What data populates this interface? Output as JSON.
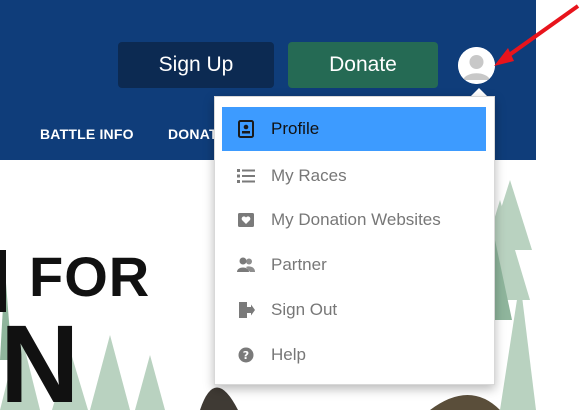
{
  "header": {
    "signup_label": "Sign Up",
    "donate_label": "Donate",
    "nav": [
      {
        "label": "BATTLE INFO"
      },
      {
        "label": "DONATE"
      }
    ]
  },
  "hero": {
    "text_for": "FOR",
    "text_n": "N"
  },
  "menu": {
    "items": [
      {
        "label": "Profile",
        "icon": "profile-card-icon",
        "active": true
      },
      {
        "label": "My Races",
        "icon": "list-icon"
      },
      {
        "label": "My Donation Websites",
        "icon": "heart-window-icon"
      },
      {
        "label": "Partner",
        "icon": "users-icon"
      },
      {
        "label": "Sign Out",
        "icon": "sign-out-icon"
      },
      {
        "label": "Help",
        "icon": "question-circle-icon"
      }
    ]
  },
  "colors": {
    "header_bg": "#0f3d7a",
    "signup_bg": "#0c2a52",
    "donate_bg": "#256a54",
    "active_item": "#3d9bff",
    "annotation_arrow": "#e8141c"
  }
}
